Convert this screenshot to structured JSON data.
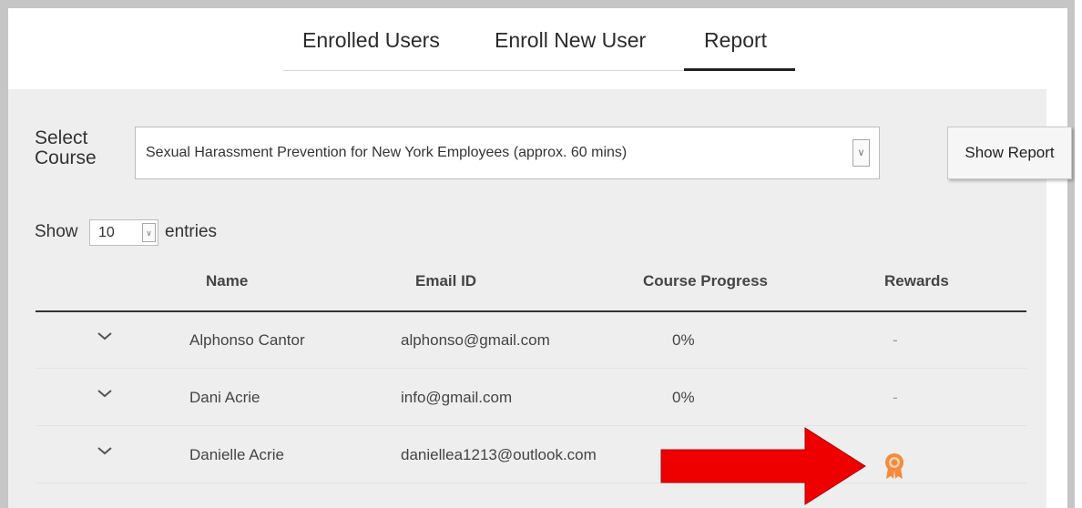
{
  "tabs": [
    {
      "label": "Enrolled Users"
    },
    {
      "label": "Enroll New User"
    },
    {
      "label": "Report"
    }
  ],
  "active_tab": "Report",
  "course_selector": {
    "label": "Select Course",
    "selected": "Sexual Harassment Prevention for New York Employees (approx. 60 mins)"
  },
  "show_report_label": "Show Report",
  "entries": {
    "prefix": "Show",
    "value": "10",
    "suffix": "entries"
  },
  "table": {
    "columns": [
      "Name",
      "Email ID",
      "Course Progress",
      "Rewards"
    ],
    "rows": [
      {
        "name": "Alphonso Cantor",
        "email": "alphonso@gmail.com",
        "progress": "0%",
        "rewards": "-"
      },
      {
        "name": "Dani Acrie",
        "email": "info@gmail.com",
        "progress": "0%",
        "rewards": "-"
      },
      {
        "name": "Danielle Acrie",
        "email": "daniellea1213@outlook.com",
        "progress": "",
        "rewards": "award-medal-icon"
      }
    ]
  },
  "colors": {
    "panel_bg": "#eeeeee",
    "annotation_arrow": "#ee0000",
    "medal": "#f58a3c"
  }
}
